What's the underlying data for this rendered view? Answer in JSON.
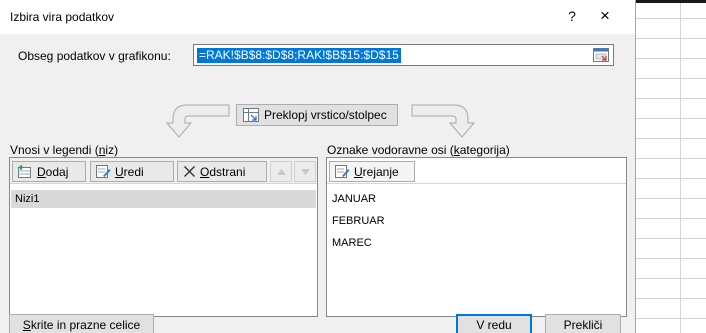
{
  "dialog": {
    "title": "Izbira vira podatkov",
    "help": "?",
    "close": "×"
  },
  "range": {
    "label_pre": "Obseg podatkov v ",
    "label_key": "g",
    "label_post": "rafikonu:",
    "value": "=RAK!$B$8:$D$8;RAK!$B$15:$D$15",
    "collapse_icon": "collapse-dialog-icon"
  },
  "switch": {
    "label_pre": "Preklop",
    "label_key": "j",
    "label_post": " vrstico/stolpec"
  },
  "legend": {
    "label_pre": "Vnosi v legendi (",
    "label_key": "n",
    "label_post": "iz)",
    "add_key": "D",
    "add_rest": "odaj",
    "edit_key": "U",
    "edit_rest": "redi",
    "remove_key": "O",
    "remove_rest": "dstrani",
    "items": [
      "Nizi1"
    ]
  },
  "axis": {
    "label_pre": "Oznake vodoravne osi (",
    "label_key": "k",
    "label_post": "ategorija)",
    "edit_key": "U",
    "edit_rest": "rejanje",
    "items": [
      "JANUAR",
      "FEBRUAR",
      "MAREC"
    ]
  },
  "footer": {
    "hidden_key": "S",
    "hidden_rest": "krite in prazne celice",
    "ok": "V redu",
    "cancel": "Prekliči"
  },
  "colors": {
    "accent": "#0078d7",
    "selection_row": "#d9d9d9"
  }
}
